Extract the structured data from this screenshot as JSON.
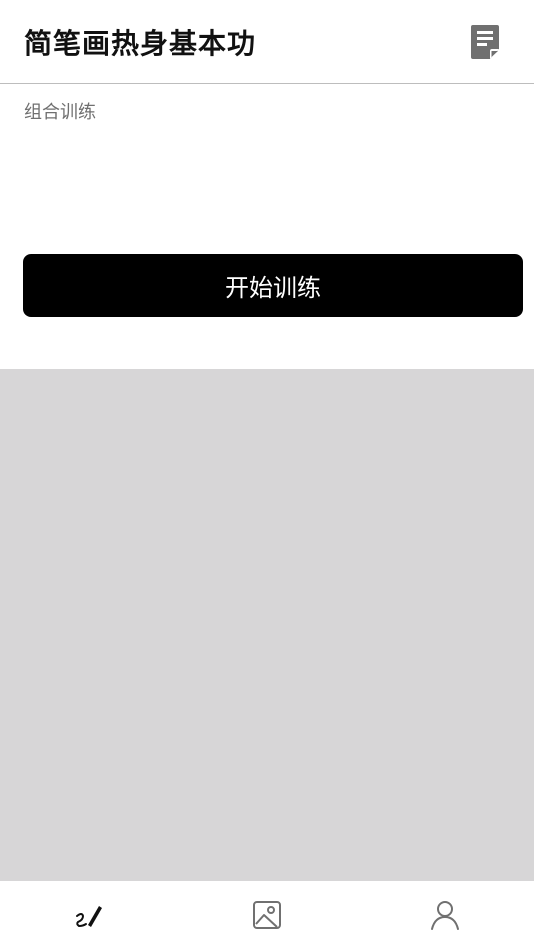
{
  "header": {
    "title": "简笔画热身基本功",
    "menu_icon": "document-icon"
  },
  "section": {
    "label": "组合训练"
  },
  "start_button": {
    "label": "开始训练"
  },
  "colors": {
    "button_bg": "#000000",
    "content_bg": "#d7d6d7",
    "icon_gray": "#707070"
  },
  "tabbar": {
    "tabs": [
      {
        "icon": "brush-icon",
        "active": true
      },
      {
        "icon": "image-icon",
        "active": false
      },
      {
        "icon": "user-icon",
        "active": false
      }
    ]
  }
}
